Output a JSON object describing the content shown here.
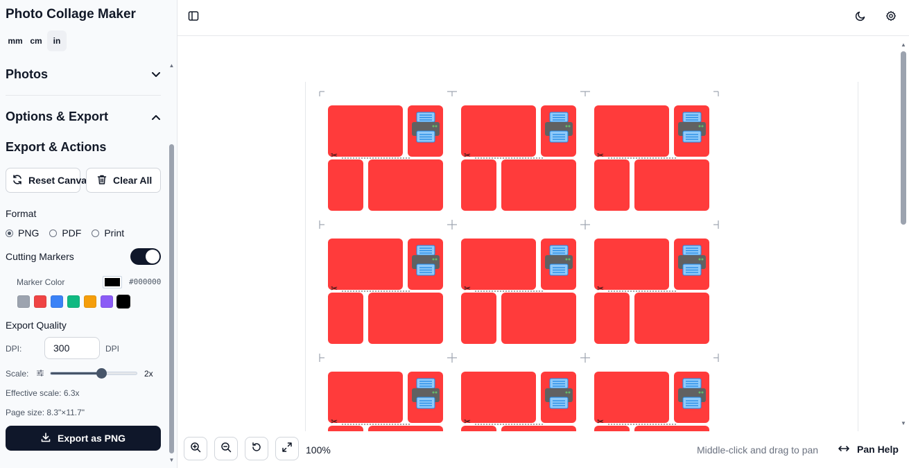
{
  "app": {
    "title": "Photo Collage Maker"
  },
  "units": [
    {
      "label": "mm",
      "active": false
    },
    {
      "label": "cm",
      "active": false
    },
    {
      "label": "in",
      "active": true
    }
  ],
  "sections": {
    "photos": "Photos",
    "options_export": "Options & Export",
    "export_actions": "Export & Actions"
  },
  "actions": {
    "reset_canvas": "Reset Canvas",
    "clear_all": "Clear All"
  },
  "format": {
    "label": "Format",
    "options": [
      "PNG",
      "PDF",
      "Print"
    ],
    "selected": "PNG"
  },
  "cutting_markers": {
    "label": "Cutting Markers",
    "enabled": true,
    "marker_color_label": "Marker Color",
    "marker_color": "#000000",
    "swatches": [
      "#9ca3af",
      "#ef4444",
      "#3b82f6",
      "#10b981",
      "#f59e0b",
      "#8b5cf6",
      "#000000"
    ]
  },
  "export_quality": {
    "label": "Export Quality",
    "dpi_label": "DPI:",
    "dpi_value": "300",
    "dpi_unit": "DPI",
    "scale_label": "Scale:",
    "scale_value": "2x",
    "scale_fraction": 0.55,
    "effective_scale": "Effective scale: 6.3x",
    "page_size": "Page size: 8.3\"×11.7\""
  },
  "export_button": "Export as PNG",
  "canvas": {
    "zoom": "100%",
    "pan_hint": "Middle-click and drag to pan",
    "pan_help": "Pan Help",
    "photo_color": "#ff3b3b",
    "grid_columns": 3,
    "grid_rows": 3
  },
  "icons": {
    "sidebar_toggle": "panel-left-icon",
    "theme": "moon-icon",
    "settings": "gear-icon",
    "placeholder": "printer-icon",
    "cut": "scissors-icon"
  }
}
